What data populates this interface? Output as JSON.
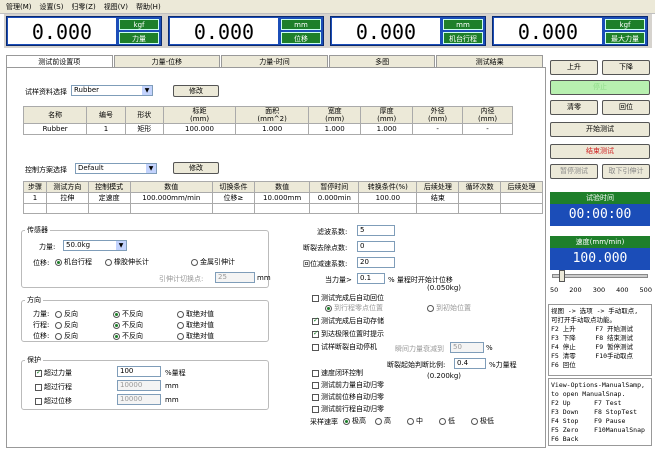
{
  "menu": [
    "管理(M)",
    "设置(S)",
    "归零(Z)",
    "视图(V)",
    "帮助(H)"
  ],
  "readouts": [
    {
      "value": "0.000",
      "unit": "kgf",
      "label": "力量"
    },
    {
      "value": "0.000",
      "unit": "mm",
      "label": "位移"
    },
    {
      "value": "0.000",
      "unit": "mm",
      "label": "机台行程"
    },
    {
      "value": "0.000",
      "unit": "kgf",
      "label": "最大力量"
    }
  ],
  "tabs": [
    "测试前设置项",
    "力量-位移",
    "力量-时间",
    "多图",
    "测试结果"
  ],
  "material": {
    "label": "试样资料选择",
    "selected": "Rubber",
    "modify": "修改",
    "headers": [
      "名称",
      "编号",
      "形状",
      "标距\n(mm)",
      "面积\n(mm^2)",
      "宽度\n(mm)",
      "厚度\n(mm)",
      "外径\n(mm)",
      "内径\n(mm)"
    ],
    "row": [
      "Rubber",
      "1",
      "矩形",
      "100.000",
      "1.000",
      "1.000",
      "1.000",
      "-",
      "-"
    ]
  },
  "control": {
    "label": "控制方案选择",
    "selected": "Default",
    "modify": "修改",
    "headers": [
      "步骤",
      "测试方向",
      "控制模式",
      "数值",
      "切换条件",
      "数值",
      "暂停时间",
      "转换条件(%)",
      "后续处理",
      "循环次数",
      "后续处理"
    ],
    "row": [
      "1",
      "拉伸",
      "定速度",
      "100.000mm/min",
      "位移≥",
      "10.000mm",
      "0.000min",
      "100.00",
      "结束",
      "",
      ""
    ]
  },
  "sensor": {
    "title": "传感器",
    "force_label": "力量:",
    "force_value": "50.0kg",
    "pos_label": "位移:",
    "pos_opts": [
      "机台行程",
      "橡胶伸长计",
      "金属引伸计"
    ],
    "switch_label": "引伸计切换点:",
    "switch_value": "25",
    "switch_unit": "mm"
  },
  "direction": {
    "title": "方向",
    "rows": [
      "力量:",
      "行程:",
      "位移:"
    ],
    "opts": [
      "反向",
      "不反向",
      "取绝对值"
    ]
  },
  "protect": {
    "title": "保护",
    "items": [
      {
        "label": "超过力量",
        "value": "100",
        "unit": "%量程",
        "on": true
      },
      {
        "label": "超过行程",
        "value": "10000",
        "unit": "mm",
        "on": false
      },
      {
        "label": "超过位移",
        "value": "10000",
        "unit": "mm",
        "on": false
      }
    ]
  },
  "settings": {
    "filter_label": "滤波系数:",
    "filter_value": "5",
    "breakpts_label": "断裂去除点数:",
    "breakpts_value": "0",
    "return_label": "回位减速系数:",
    "return_value": "20",
    "force_start_label": "当力量>",
    "force_start_value": "0.1",
    "force_start_unit": "% 量程时开始计位移",
    "force_start_note": "(0.050kg)",
    "auto_return": "测试完成后自动回位",
    "ret_opts": [
      "到行程零点位置",
      "到初始位置"
    ],
    "auto_save": "测试完成后自动存储",
    "limit_notify": "到达极限位置时提示",
    "break_stop": "试样断裂自动停机",
    "break_force_label": "瞬间力量衰减到",
    "break_force_value": "50",
    "break_force_unit": "%",
    "break_start_label": "断裂起始判断比例:",
    "break_start_value": "0.4",
    "break_start_unit": "%力量程",
    "break_start_note": "(0.200kg)",
    "closed_loop": "速度闭环控制",
    "zero_force": "测试前力量自动归零",
    "zero_disp": "测试前位移自动归零",
    "zero_stroke": "测试前行程自动归零",
    "rate_label": "采样速率",
    "rates": [
      "极高",
      "高",
      "中",
      "低",
      "极低"
    ]
  },
  "right": {
    "up": "上升",
    "down": "下降",
    "stop": "停止",
    "clear": "清零",
    "return": "回位",
    "start": "开始测试",
    "end": "结束测试",
    "pause": "暂停测试",
    "remove": "取下引伸计",
    "time_title": "试验时间",
    "time_value": "00:00:00",
    "speed_title": "速度(mm/min)",
    "speed_value": "100.000",
    "slider_ticks": [
      "50",
      "200",
      "300",
      "400",
      "500"
    ],
    "slider_pct": 0.08,
    "help1": "视图 -> 选项 -> 手动取点,\n可打开手动取点功能。\nF2 上升     F7 开始测试\nF3 下降     F8 结束测试\nF4 停止     F9 暂停测试\nF5 清零     F10手动取点\nF6 回位",
    "help2": "View-Options-ManualSamp,\nto open ManualSnap.\nF2 Up      F7 Test\nF3 Down    F8 StopTest\nF4 Stop    F9 Pause\nF5 Zero    F10ManualSnap\nF6 Back"
  }
}
